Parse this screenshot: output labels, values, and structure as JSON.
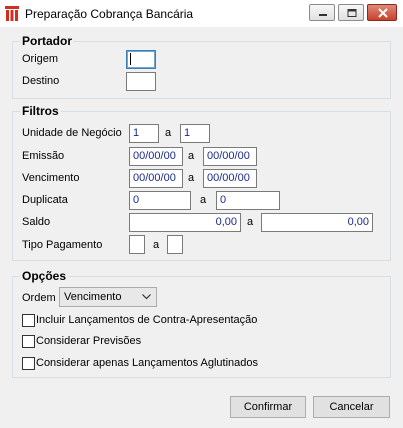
{
  "window": {
    "title": "Preparação Cobrança Bancária",
    "controls": [
      "minimize-icon",
      "maximize-icon",
      "close-icon"
    ],
    "accent_colors": {
      "app_icon": "#d22e1e",
      "close_button": "#c9412b",
      "date_text": "#1b2a8c"
    }
  },
  "portador": {
    "legend": "Portador",
    "origem_label": "Origem",
    "origem_value": "",
    "destino_label": "Destino",
    "destino_value": ""
  },
  "filtros": {
    "legend": "Filtros",
    "unidade": {
      "label": "Unidade de Negócio",
      "from": "1",
      "sep": "a",
      "to": "1"
    },
    "emissao": {
      "label": "Emissão",
      "from": "00/00/00",
      "sep": "a",
      "to": "00/00/00"
    },
    "vencimento": {
      "label": "Vencimento",
      "from": "00/00/00",
      "sep": "a",
      "to": "00/00/00"
    },
    "duplicata": {
      "label": "Duplicata",
      "from": "0",
      "sep": "a",
      "to": "0"
    },
    "saldo": {
      "label": "Saldo",
      "from": "0,00",
      "sep": "a",
      "to": "0,00"
    },
    "tipo_pagamento": {
      "label": "Tipo Pagamento",
      "from": "",
      "sep": "a",
      "to": ""
    }
  },
  "opcoes": {
    "legend": "Opções",
    "ordem_label": "Ordem",
    "ordem_value": "Vencimento",
    "checkboxes": [
      {
        "label": "Incluir Lançamentos de Contra-Apresentação",
        "checked": false
      },
      {
        "label": "Considerar Previsões",
        "checked": false
      },
      {
        "label": "Considerar apenas Lançamentos Aglutinados",
        "checked": false
      }
    ]
  },
  "buttons": {
    "confirm": "Confirmar",
    "cancel": "Cancelar"
  }
}
